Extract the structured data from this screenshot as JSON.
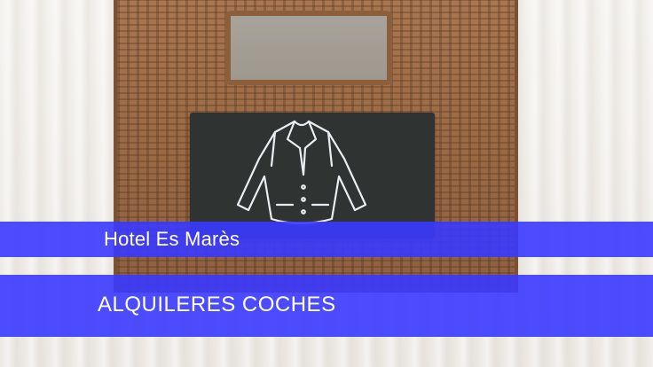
{
  "banner": {
    "title": "Hotel Es Marès",
    "subtitle": "ALQUILERES COCHES",
    "band_color": "#3a3aff",
    "text_color": "#ffffff"
  },
  "scene": {
    "icon": "jacket-icon",
    "chalk_color": "#e8eef2"
  }
}
